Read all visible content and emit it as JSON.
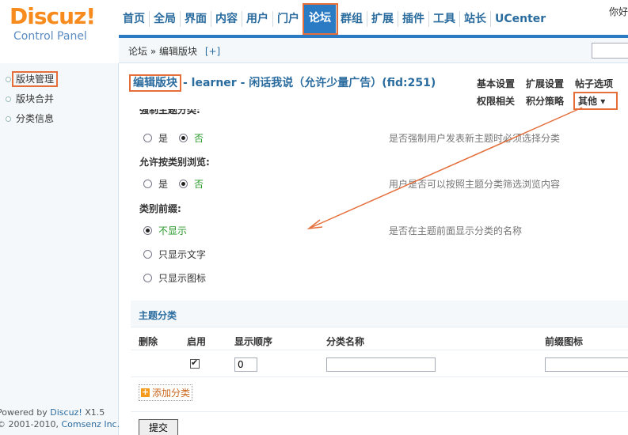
{
  "header": {
    "logo_brand": "Discuz!",
    "logo_sub": "Control Panel",
    "greeting": "你好",
    "nav": [
      "首页",
      "全局",
      "界面",
      "内容",
      "用户",
      "门户",
      "论坛",
      "群组",
      "扩展",
      "插件",
      "工具",
      "站长",
      "UCenter"
    ],
    "active_nav": "论坛"
  },
  "breadcrumb": {
    "path": "论坛 » 编辑版块",
    "add": "[+]"
  },
  "sidebar": {
    "items": [
      {
        "label": "版块管理",
        "active": true
      },
      {
        "label": "版块合并",
        "active": false
      },
      {
        "label": "分类信息",
        "active": false
      }
    ],
    "footer_line1_prefix": "Powered by ",
    "footer_line1_brand": "Discuz!",
    "footer_line1_ver": " X1.5",
    "footer_line2_prefix": "© 2001-2010, ",
    "footer_line2_brand": "Comsenz Inc."
  },
  "page": {
    "title_highlight": "编辑版块",
    "title_rest": "- learner - 闲话我说（允许少量广告）(fid:251)",
    "tabs_row1": [
      "基本设置",
      "扩展设置",
      "帖子选项"
    ],
    "tabs_row2": [
      "权限相关",
      "积分策略"
    ],
    "tabs_more": "其他 ▾",
    "partial_label": "强制主题分类:"
  },
  "settings": [
    {
      "key": "force",
      "options": [
        {
          "label": "是",
          "checked": false
        },
        {
          "label": "否",
          "checked": true
        }
      ],
      "hint": "是否强制用户发表新主题时必须选择分类"
    },
    {
      "key": "browse",
      "label": "允许按类别浏览:",
      "options": [
        {
          "label": "是",
          "checked": false
        },
        {
          "label": "否",
          "checked": true
        }
      ],
      "hint": "用户是否可以按照主题分类筛选浏览内容"
    },
    {
      "key": "prefix",
      "label": "类别前缀:",
      "options": [
        {
          "label": "不显示",
          "checked": true
        },
        {
          "label": "只显示文字",
          "checked": false
        },
        {
          "label": "只显示图标",
          "checked": false
        }
      ],
      "hint": "是否在主题前面显示分类的名称"
    }
  ],
  "thread_types": {
    "section_title": "主题分类",
    "columns": [
      "删除",
      "启用",
      "显示顺序",
      "分类名称",
      "前缀图标"
    ],
    "new_row": {
      "enabled": true,
      "order": "0",
      "name": "",
      "icon": ""
    },
    "add_label": "添加分类",
    "submit_label": "提交"
  },
  "colors": {
    "accent": "#2b7bc4",
    "annotation": "#e46f3b",
    "brand_orange": "#f78b1e"
  }
}
